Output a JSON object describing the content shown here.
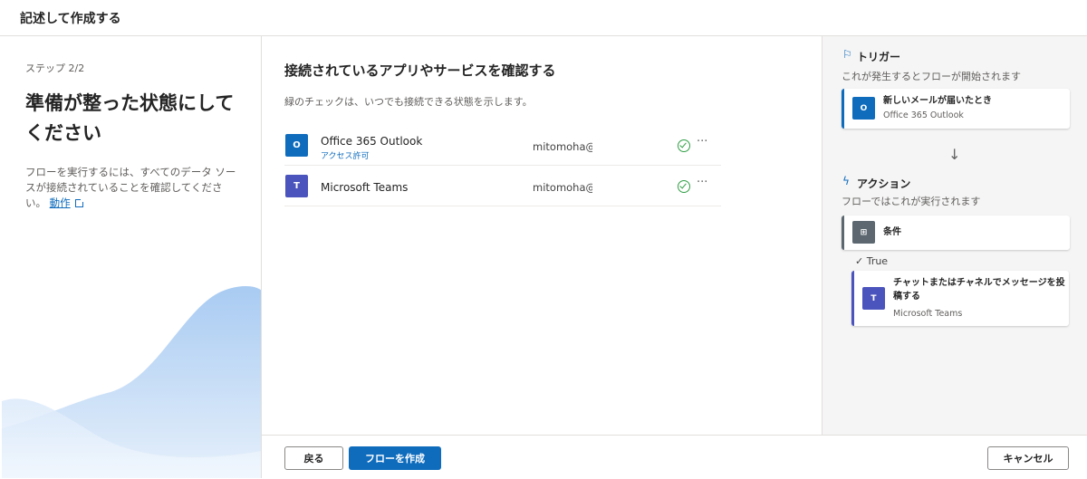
{
  "header": {
    "title": "記述して作成する"
  },
  "left": {
    "step": "ステップ 2/2",
    "heading": "準備が整った状態にしてください",
    "description": "フローを実行するには、すべてのデータ ソースが接続されていることを確認してください。",
    "link": "動作"
  },
  "main": {
    "title": "接続されているアプリやサービスを確認する",
    "subtitle": "緑のチェックは、いつでも接続できる状態を示します。",
    "connections": [
      {
        "name": "Office 365 Outlook",
        "sub": "アクセス許可",
        "account": "mitomoha@",
        "icon": "outlook-icon",
        "color": "#0f6cbd"
      },
      {
        "name": "Microsoft Teams",
        "sub": "",
        "account": "mitomoha@",
        "icon": "teams-icon",
        "color": "#4b53bc"
      }
    ],
    "more": "···"
  },
  "footer": {
    "back": "戻る",
    "create": "フローを作成",
    "cancel": "キャンセル"
  },
  "flow": {
    "trigger_title": "トリガー",
    "trigger_sub": "これが発生するとフローが開始されます",
    "trigger_card": {
      "title": "新しいメールが届いたとき",
      "sub": "Office 365 Outlook"
    },
    "arrow": "↓",
    "action_title": "アクション",
    "action_sub": "フローではこれが実行されます",
    "condition_card": {
      "title": "条件"
    },
    "true_label": "✓  True",
    "teams_card": {
      "title": "チャットまたはチャネルでメッセージを投稿する",
      "sub": "Microsoft Teams"
    }
  },
  "colors": {
    "accent": "#0f6cbd",
    "teams": "#4b53bc",
    "condition": "#5c6770",
    "check": "#2f9e44"
  }
}
